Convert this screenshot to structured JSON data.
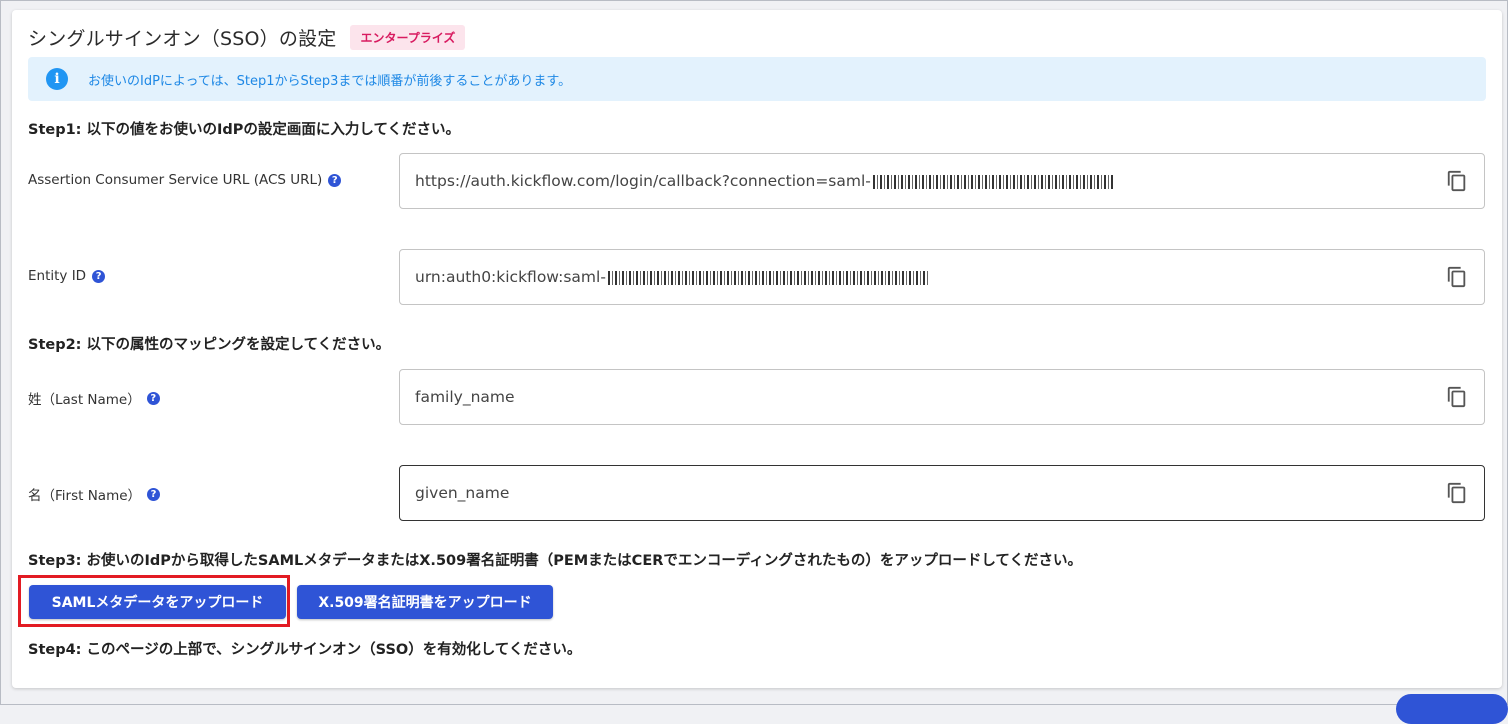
{
  "header": {
    "title": "シングルサインオン（SSO）の設定",
    "badge": "エンタープライズ"
  },
  "alert": {
    "icon": "info-icon",
    "text": "お使いのIdPによっては、Step1からStep3までは順番が前後することがあります。"
  },
  "step1": {
    "heading": "Step1: 以下の値をお使いのIdPの設定画面に入力してください。",
    "fields": [
      {
        "label": "Assertion Consumer Service URL (ACS URL)",
        "value": "https://auth.kickflow.com/login/callback?connection=saml-"
      },
      {
        "label": "Entity ID",
        "value": "urn:auth0:kickflow:saml-"
      }
    ]
  },
  "step2": {
    "heading": "Step2: 以下の属性のマッピングを設定してください。",
    "fields": [
      {
        "label": "姓（Last Name）",
        "value": "family_name"
      },
      {
        "label": "名（First Name）",
        "value": "given_name"
      }
    ]
  },
  "step3": {
    "heading": "Step3: お使いのIdPから取得したSAMLメタデータまたはX.509署名証明書（PEMまたはCERでエンコーディングされたもの）をアップロードしてください。",
    "upload_metadata_label": "SAMLメタデータをアップロード",
    "upload_cert_label": "X.509署名証明書をアップロード"
  },
  "step4": {
    "heading": "Step4: このページの上部で、シングルサインオン（SSO）を有効化してください。"
  },
  "colors": {
    "primary": "#2f54d6",
    "badge_bg": "#fce4ec",
    "badge_text": "#d81b60",
    "alert_bg": "#e3f2fd",
    "alert_text": "#1e88e5",
    "highlight": "#e21b23"
  }
}
